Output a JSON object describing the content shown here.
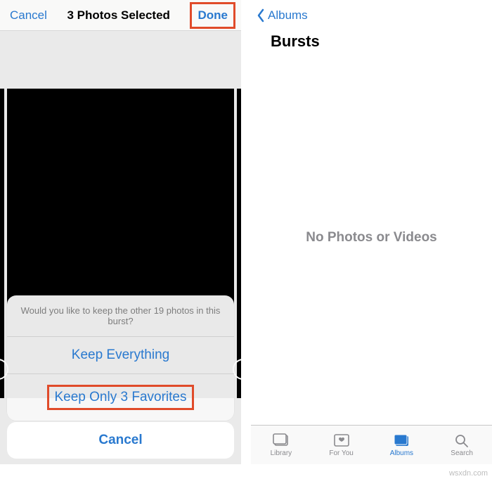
{
  "left": {
    "header": {
      "cancel": "Cancel",
      "title": "3 Photos Selected",
      "done": "Done"
    },
    "sheet": {
      "prompt": "Would you like to keep the other 19 photos in this burst?",
      "keep_all": "Keep Everything",
      "keep_fav": "Keep Only 3 Favorites",
      "cancel": "Cancel"
    }
  },
  "right": {
    "back_label": "Albums",
    "title": "Bursts",
    "empty": "No Photos or Videos",
    "tabs": {
      "library": "Library",
      "foryou": "For You",
      "albums": "Albums",
      "search": "Search"
    }
  },
  "watermark": "wsxdn.com",
  "colors": {
    "accent": "#2979cf",
    "highlight": "#e04b2a"
  }
}
